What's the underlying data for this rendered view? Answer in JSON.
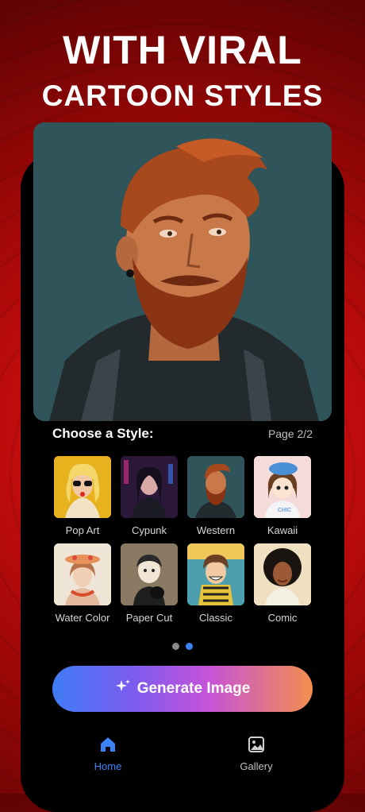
{
  "headline": {
    "line1": "WITH VIRAL",
    "line2": "CARTOON STYLES"
  },
  "styles_section": {
    "title": "Choose a Style:",
    "page_indicator": "Page 2/2"
  },
  "styles": [
    {
      "label": "Pop Art"
    },
    {
      "label": "Cypunk"
    },
    {
      "label": "Western"
    },
    {
      "label": "Kawaii"
    },
    {
      "label": "Water Color"
    },
    {
      "label": "Paper Cut"
    },
    {
      "label": "Classic"
    },
    {
      "label": "Comic"
    }
  ],
  "kawaii_tile_text": "CHIC",
  "pagination": {
    "total": 2,
    "active": 2
  },
  "generate_button": {
    "label": "Generate Image",
    "icon": "sparkle-icon"
  },
  "bottom_nav": [
    {
      "label": "Home",
      "icon": "home-icon",
      "active": true
    },
    {
      "label": "Gallery",
      "icon": "image-icon",
      "active": false
    }
  ],
  "colors": {
    "background_red": "#c20c0c",
    "accent_blue": "#3b82f6",
    "button_gradient_start": "#3f7cf5",
    "button_gradient_end": "#f38e4e"
  }
}
